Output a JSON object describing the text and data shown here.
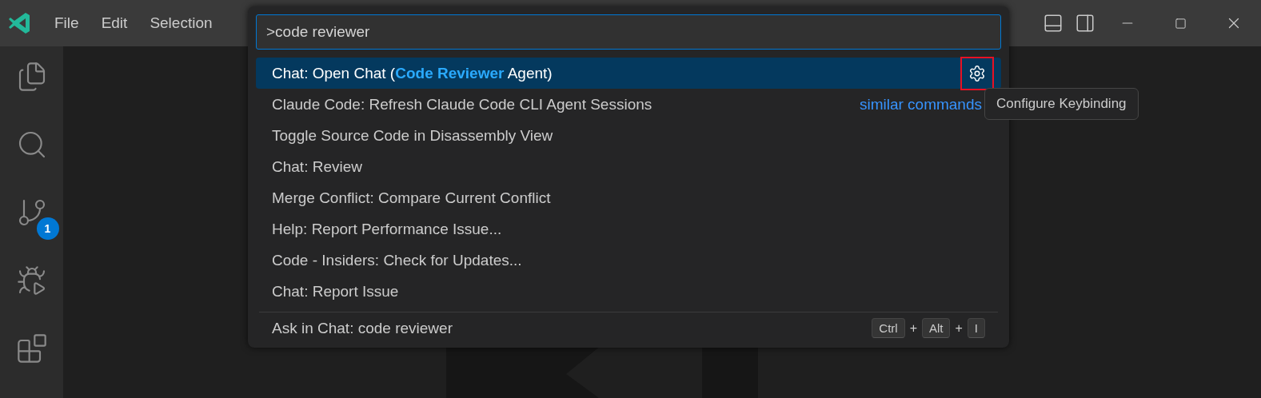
{
  "title_bar": {
    "menu": [
      "File",
      "Edit",
      "Selection"
    ]
  },
  "activity_bar": {
    "items": [
      {
        "kind": "explorer"
      },
      {
        "kind": "search"
      },
      {
        "kind": "source-control",
        "badge": "1"
      },
      {
        "kind": "debug"
      },
      {
        "kind": "extensions"
      }
    ]
  },
  "quick_pick": {
    "input": {
      "value": ">code reviewer"
    },
    "items": [
      {
        "label": "Chat: Open Chat (**Code Reviewer** Agent)",
        "selected": true,
        "action": {
          "kind": "gear",
          "highlighted": true
        }
      },
      {
        "label": "Claude Code: Refresh Claude Code CLI Agent Sessions",
        "selected": false,
        "aside": "similar commands"
      },
      {
        "label": "Toggle Source Code in Disassembly View",
        "selected": false
      },
      {
        "label": "Chat: Review",
        "selected": false
      },
      {
        "label": "Merge Conflict: Compare Current Conflict",
        "selected": false
      },
      {
        "label": "Help: Report Performance Issue...",
        "selected": false
      },
      {
        "label": "Code - Insiders: Check for Updates...",
        "selected": false
      },
      {
        "label": "Chat: Report Issue",
        "selected": false
      }
    ],
    "footer_item": {
      "label": "Ask in Chat: code reviewer",
      "keybinding": [
        {
          "kind": "key",
          "label": "Ctrl"
        },
        {
          "kind": "plus",
          "label": "+"
        },
        {
          "kind": "key",
          "label": "Alt"
        },
        {
          "kind": "plus",
          "label": "+"
        },
        {
          "kind": "key",
          "label": "I"
        }
      ]
    }
  },
  "tooltip": {
    "text": "Configure Keybinding"
  }
}
